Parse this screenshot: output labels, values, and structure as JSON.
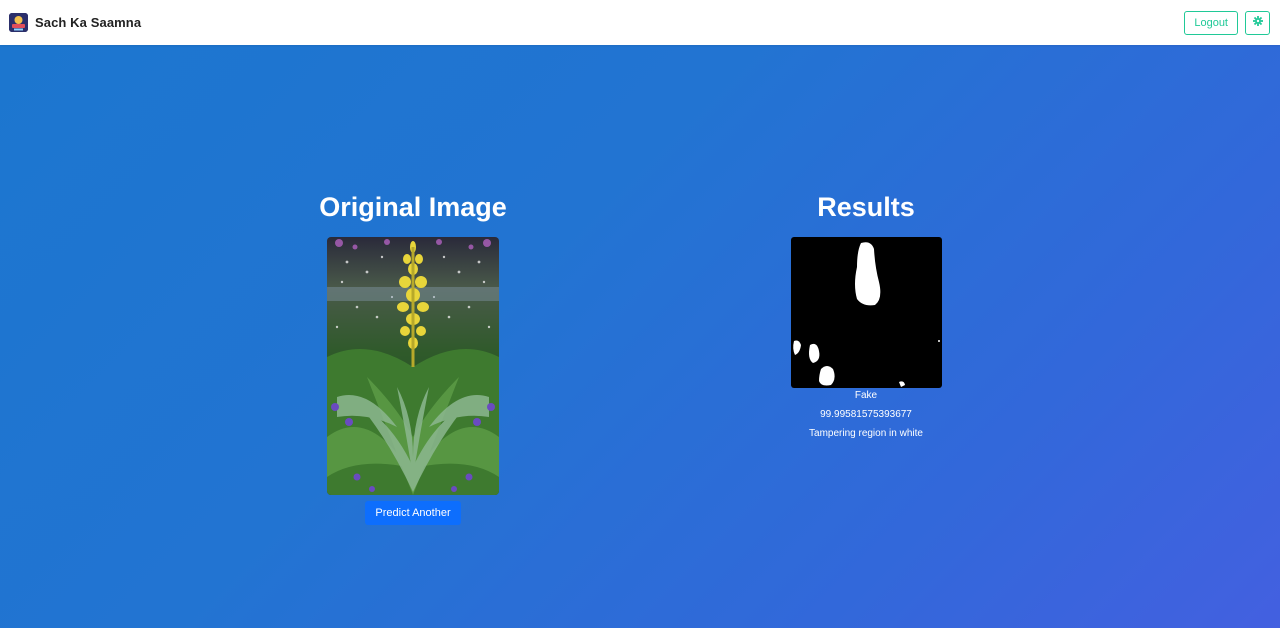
{
  "header": {
    "brand_name": "Sach Ka Saamna",
    "logo_icon": "brand-logo-icon",
    "logout_label": "Logout",
    "settings_icon": "gear-icon",
    "accent_color": "#20c997"
  },
  "original": {
    "title": "Original Image",
    "predict_label": "Predict Another"
  },
  "results": {
    "title": "Results",
    "label": "Fake",
    "score": "99.99581575393677",
    "note": "Tampering region in white"
  },
  "colors": {
    "background_start": "#1c76cf",
    "background_end": "#4360e0",
    "primary_button": "#0d6efd"
  }
}
